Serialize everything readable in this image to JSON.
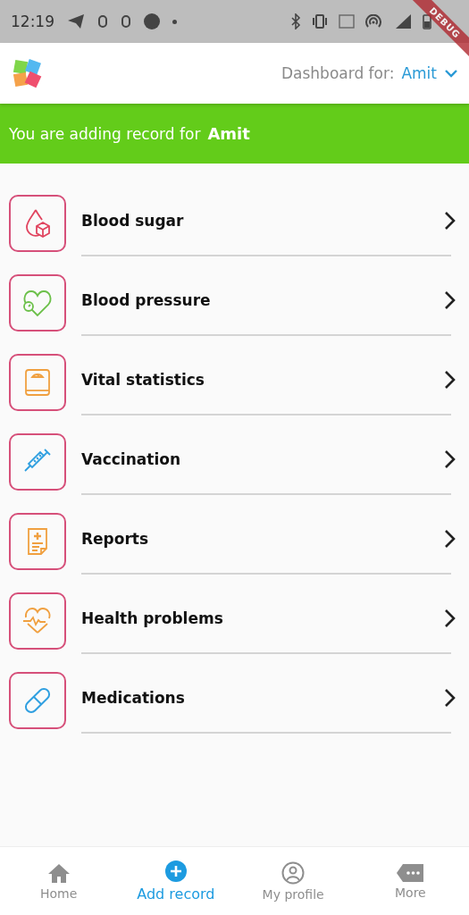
{
  "status_bar": {
    "time": "12:19"
  },
  "debug_banner": {
    "label": "DEBUG"
  },
  "app_bar": {
    "dashboard_label": "Dashboard for:",
    "person": "Amit"
  },
  "banner": {
    "text": "You are adding record for",
    "person": "Amit"
  },
  "records": [
    {
      "kind": "sugar",
      "label": "Blood sugar"
    },
    {
      "kind": "pressure",
      "label": "Blood pressure"
    },
    {
      "kind": "vitals",
      "label": "Vital statistics"
    },
    {
      "kind": "vaccine",
      "label": "Vaccination"
    },
    {
      "kind": "report",
      "label": "Reports"
    },
    {
      "kind": "health",
      "label": "Health problems"
    },
    {
      "kind": "medication",
      "label": "Medications"
    }
  ],
  "bottom_nav": [
    {
      "kind": "home",
      "label": "Home",
      "selected": false
    },
    {
      "kind": "add",
      "label": "Add record",
      "selected": true
    },
    {
      "kind": "profile",
      "label": "My profile",
      "selected": false
    },
    {
      "kind": "more",
      "label": "More",
      "selected": false
    }
  ]
}
